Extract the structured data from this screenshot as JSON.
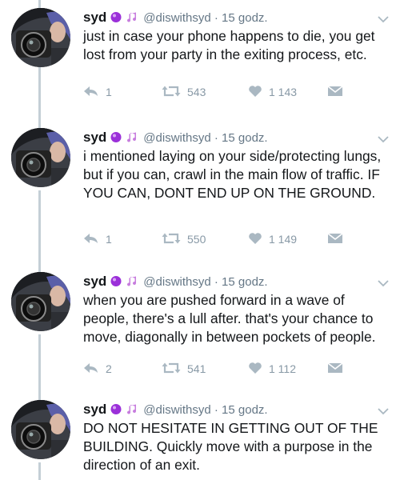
{
  "tweets": [
    {
      "display_name": "syd",
      "handle_time": "@diswithsyd · 15 godz.",
      "text": "just in case your phone happens to die, you get lost from your party in the exiting process, etc.",
      "replies": "1",
      "retweets": "543",
      "likes": "1 143"
    },
    {
      "display_name": "syd",
      "handle_time": "@diswithsyd · 15 godz.",
      "text": "i mentioned laying on your side/protecting lungs, but if you can, crawl in the main flow of traffic. IF YOU CAN, DONT END UP ON THE GROUND.",
      "replies": "1",
      "retweets": "550",
      "likes": "1 149"
    },
    {
      "display_name": "syd",
      "handle_time": "@diswithsyd · 15 godz.",
      "text": "when you are pushed forward in a wave of people, there's a lull after. that's your chance to move, diagonally in between pockets of people.",
      "replies": "2",
      "retweets": "541",
      "likes": "1 112"
    },
    {
      "display_name": "syd",
      "handle_time": "@diswithsyd · 15 godz.",
      "text": "DO NOT HESITATE IN GETTING OUT OF THE BUILDING. Quickly move with a purpose in the direction of an exit."
    }
  ],
  "colors": {
    "text": "#14171a",
    "secondary": "#657786",
    "action": "#8899a6",
    "badge_purple": "#9b30d9",
    "thread_line": "#c4cfd6"
  },
  "icons": [
    "purple-orb-icon",
    "music-note-icon",
    "chevron-down-icon",
    "reply-icon",
    "retweet-icon",
    "heart-icon",
    "dm-envelope-icon"
  ]
}
